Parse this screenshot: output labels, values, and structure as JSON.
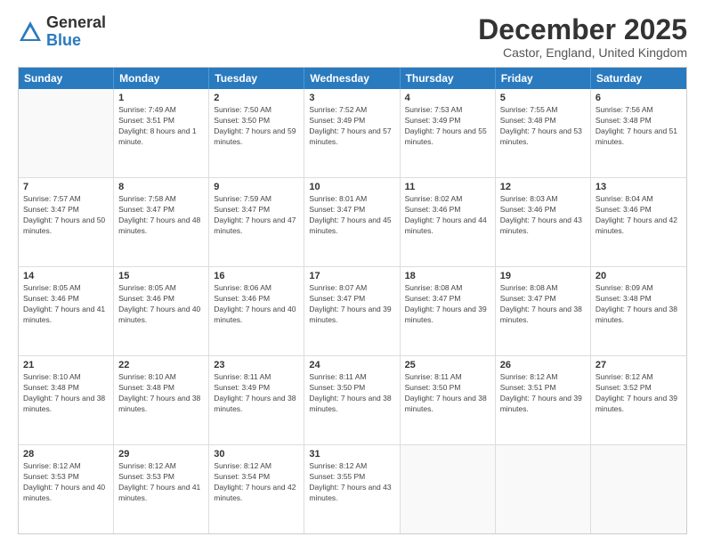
{
  "logo": {
    "general": "General",
    "blue": "Blue"
  },
  "title": "December 2025",
  "location": "Castor, England, United Kingdom",
  "days_of_week": [
    "Sunday",
    "Monday",
    "Tuesday",
    "Wednesday",
    "Thursday",
    "Friday",
    "Saturday"
  ],
  "weeks": [
    [
      {
        "day": "",
        "sunrise": "",
        "sunset": "",
        "daylight": "",
        "empty": true
      },
      {
        "day": "1",
        "sunrise": "Sunrise: 7:49 AM",
        "sunset": "Sunset: 3:51 PM",
        "daylight": "Daylight: 8 hours and 1 minute."
      },
      {
        "day": "2",
        "sunrise": "Sunrise: 7:50 AM",
        "sunset": "Sunset: 3:50 PM",
        "daylight": "Daylight: 7 hours and 59 minutes."
      },
      {
        "day": "3",
        "sunrise": "Sunrise: 7:52 AM",
        "sunset": "Sunset: 3:49 PM",
        "daylight": "Daylight: 7 hours and 57 minutes."
      },
      {
        "day": "4",
        "sunrise": "Sunrise: 7:53 AM",
        "sunset": "Sunset: 3:49 PM",
        "daylight": "Daylight: 7 hours and 55 minutes."
      },
      {
        "day": "5",
        "sunrise": "Sunrise: 7:55 AM",
        "sunset": "Sunset: 3:48 PM",
        "daylight": "Daylight: 7 hours and 53 minutes."
      },
      {
        "day": "6",
        "sunrise": "Sunrise: 7:56 AM",
        "sunset": "Sunset: 3:48 PM",
        "daylight": "Daylight: 7 hours and 51 minutes."
      }
    ],
    [
      {
        "day": "7",
        "sunrise": "Sunrise: 7:57 AM",
        "sunset": "Sunset: 3:47 PM",
        "daylight": "Daylight: 7 hours and 50 minutes."
      },
      {
        "day": "8",
        "sunrise": "Sunrise: 7:58 AM",
        "sunset": "Sunset: 3:47 PM",
        "daylight": "Daylight: 7 hours and 48 minutes."
      },
      {
        "day": "9",
        "sunrise": "Sunrise: 7:59 AM",
        "sunset": "Sunset: 3:47 PM",
        "daylight": "Daylight: 7 hours and 47 minutes."
      },
      {
        "day": "10",
        "sunrise": "Sunrise: 8:01 AM",
        "sunset": "Sunset: 3:47 PM",
        "daylight": "Daylight: 7 hours and 45 minutes."
      },
      {
        "day": "11",
        "sunrise": "Sunrise: 8:02 AM",
        "sunset": "Sunset: 3:46 PM",
        "daylight": "Daylight: 7 hours and 44 minutes."
      },
      {
        "day": "12",
        "sunrise": "Sunrise: 8:03 AM",
        "sunset": "Sunset: 3:46 PM",
        "daylight": "Daylight: 7 hours and 43 minutes."
      },
      {
        "day": "13",
        "sunrise": "Sunrise: 8:04 AM",
        "sunset": "Sunset: 3:46 PM",
        "daylight": "Daylight: 7 hours and 42 minutes."
      }
    ],
    [
      {
        "day": "14",
        "sunrise": "Sunrise: 8:05 AM",
        "sunset": "Sunset: 3:46 PM",
        "daylight": "Daylight: 7 hours and 41 minutes."
      },
      {
        "day": "15",
        "sunrise": "Sunrise: 8:05 AM",
        "sunset": "Sunset: 3:46 PM",
        "daylight": "Daylight: 7 hours and 40 minutes."
      },
      {
        "day": "16",
        "sunrise": "Sunrise: 8:06 AM",
        "sunset": "Sunset: 3:46 PM",
        "daylight": "Daylight: 7 hours and 40 minutes."
      },
      {
        "day": "17",
        "sunrise": "Sunrise: 8:07 AM",
        "sunset": "Sunset: 3:47 PM",
        "daylight": "Daylight: 7 hours and 39 minutes."
      },
      {
        "day": "18",
        "sunrise": "Sunrise: 8:08 AM",
        "sunset": "Sunset: 3:47 PM",
        "daylight": "Daylight: 7 hours and 39 minutes."
      },
      {
        "day": "19",
        "sunrise": "Sunrise: 8:08 AM",
        "sunset": "Sunset: 3:47 PM",
        "daylight": "Daylight: 7 hours and 38 minutes."
      },
      {
        "day": "20",
        "sunrise": "Sunrise: 8:09 AM",
        "sunset": "Sunset: 3:48 PM",
        "daylight": "Daylight: 7 hours and 38 minutes."
      }
    ],
    [
      {
        "day": "21",
        "sunrise": "Sunrise: 8:10 AM",
        "sunset": "Sunset: 3:48 PM",
        "daylight": "Daylight: 7 hours and 38 minutes."
      },
      {
        "day": "22",
        "sunrise": "Sunrise: 8:10 AM",
        "sunset": "Sunset: 3:48 PM",
        "daylight": "Daylight: 7 hours and 38 minutes."
      },
      {
        "day": "23",
        "sunrise": "Sunrise: 8:11 AM",
        "sunset": "Sunset: 3:49 PM",
        "daylight": "Daylight: 7 hours and 38 minutes."
      },
      {
        "day": "24",
        "sunrise": "Sunrise: 8:11 AM",
        "sunset": "Sunset: 3:50 PM",
        "daylight": "Daylight: 7 hours and 38 minutes."
      },
      {
        "day": "25",
        "sunrise": "Sunrise: 8:11 AM",
        "sunset": "Sunset: 3:50 PM",
        "daylight": "Daylight: 7 hours and 38 minutes."
      },
      {
        "day": "26",
        "sunrise": "Sunrise: 8:12 AM",
        "sunset": "Sunset: 3:51 PM",
        "daylight": "Daylight: 7 hours and 39 minutes."
      },
      {
        "day": "27",
        "sunrise": "Sunrise: 8:12 AM",
        "sunset": "Sunset: 3:52 PM",
        "daylight": "Daylight: 7 hours and 39 minutes."
      }
    ],
    [
      {
        "day": "28",
        "sunrise": "Sunrise: 8:12 AM",
        "sunset": "Sunset: 3:53 PM",
        "daylight": "Daylight: 7 hours and 40 minutes."
      },
      {
        "day": "29",
        "sunrise": "Sunrise: 8:12 AM",
        "sunset": "Sunset: 3:53 PM",
        "daylight": "Daylight: 7 hours and 41 minutes."
      },
      {
        "day": "30",
        "sunrise": "Sunrise: 8:12 AM",
        "sunset": "Sunset: 3:54 PM",
        "daylight": "Daylight: 7 hours and 42 minutes."
      },
      {
        "day": "31",
        "sunrise": "Sunrise: 8:12 AM",
        "sunset": "Sunset: 3:55 PM",
        "daylight": "Daylight: 7 hours and 43 minutes."
      },
      {
        "day": "",
        "sunrise": "",
        "sunset": "",
        "daylight": "",
        "empty": true
      },
      {
        "day": "",
        "sunrise": "",
        "sunset": "",
        "daylight": "",
        "empty": true
      },
      {
        "day": "",
        "sunrise": "",
        "sunset": "",
        "daylight": "",
        "empty": true
      }
    ]
  ]
}
